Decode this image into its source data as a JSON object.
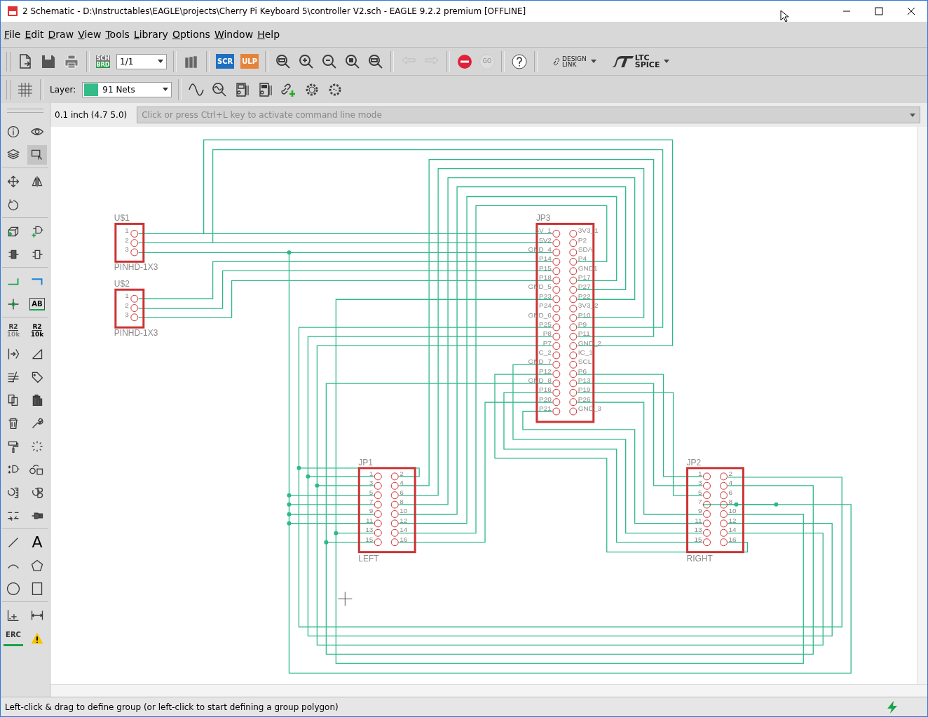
{
  "window": {
    "title": "2 Schematic - D:\\Instructables\\EAGLE\\projects\\Cherry Pi Keyboard 5\\controller V2.sch - EAGLE 9.2.2 premium [OFFLINE]"
  },
  "menu": [
    {
      "label": "File"
    },
    {
      "label": "Edit"
    },
    {
      "label": "Draw"
    },
    {
      "label": "View"
    },
    {
      "label": "Tools"
    },
    {
      "label": "Library"
    },
    {
      "label": "Options"
    },
    {
      "label": "Window"
    },
    {
      "label": "Help"
    }
  ],
  "toolbar": {
    "sch_brd": [
      "SCH",
      "BRD"
    ],
    "page": "1/1",
    "script": "SCR",
    "ulp": "ULP",
    "go": "GO",
    "design_link": [
      "DESIGN",
      "LINK"
    ],
    "ltspice": [
      "LTC",
      "SPICE"
    ]
  },
  "layer_bar": {
    "label": "Layer:",
    "layer": "91 Nets",
    "color": "#33bb88"
  },
  "grid_readout": "0.1 inch (4.7 5.0)",
  "command_line": {
    "placeholder": "Click or press Ctrl+L key to activate command line mode"
  },
  "tool_labels": {
    "label_tool": "AB",
    "name_tool": "R2",
    "name_tool_value": "10k",
    "value_tool": "R2",
    "value_tool_value": "10k",
    "text_tool": "A",
    "erc": "ERC"
  },
  "parts": [
    {
      "kind": "single",
      "name": "U$1",
      "value": "PINHD-1X3",
      "left_pins": [
        "1",
        "2",
        "3"
      ]
    },
    {
      "kind": "single",
      "name": "U$2",
      "value": "PINHD-1X3",
      "left_pins": [
        "1",
        "2",
        "3"
      ]
    },
    {
      "kind": "dual",
      "name": "JP3",
      "left_pins": [
        "5V_1",
        "5V2",
        "GND_4",
        "P14",
        "P15",
        "P18",
        "GND_5",
        "P23",
        "P24",
        "GND_6",
        "P25",
        "P8",
        "P7",
        "IC_2",
        "GND_7",
        "P12",
        "GND_8",
        "P16",
        "P20",
        "P21"
      ],
      "right_pins": [
        "3V3_1",
        "P2",
        "SDA",
        "P4",
        "GND1",
        "P17",
        "P27",
        "P22",
        "3V3_2",
        "P10",
        "P9",
        "P11",
        "GND_2",
        "IC_1",
        "SCL",
        "P6",
        "P13",
        "P19",
        "P26",
        "GND_3"
      ]
    },
    {
      "kind": "dual",
      "name": "JP1",
      "value": "LEFT",
      "left_pins": [
        "1",
        "3",
        "5",
        "7",
        "9",
        "11",
        "13",
        "15"
      ],
      "right_pins": [
        "2",
        "4",
        "6",
        "8",
        "10",
        "12",
        "14",
        "16"
      ]
    },
    {
      "kind": "dual",
      "name": "JP2",
      "value": "RIGHT",
      "left_pins": [
        "1",
        "3",
        "5",
        "7",
        "9",
        "11",
        "13",
        "15"
      ],
      "right_pins": [
        "2",
        "4",
        "6",
        "8",
        "10",
        "12",
        "14",
        "16"
      ]
    }
  ],
  "status_bar": {
    "message": "Left-click & drag to define group (or left-click to start defining a group polygon)"
  }
}
